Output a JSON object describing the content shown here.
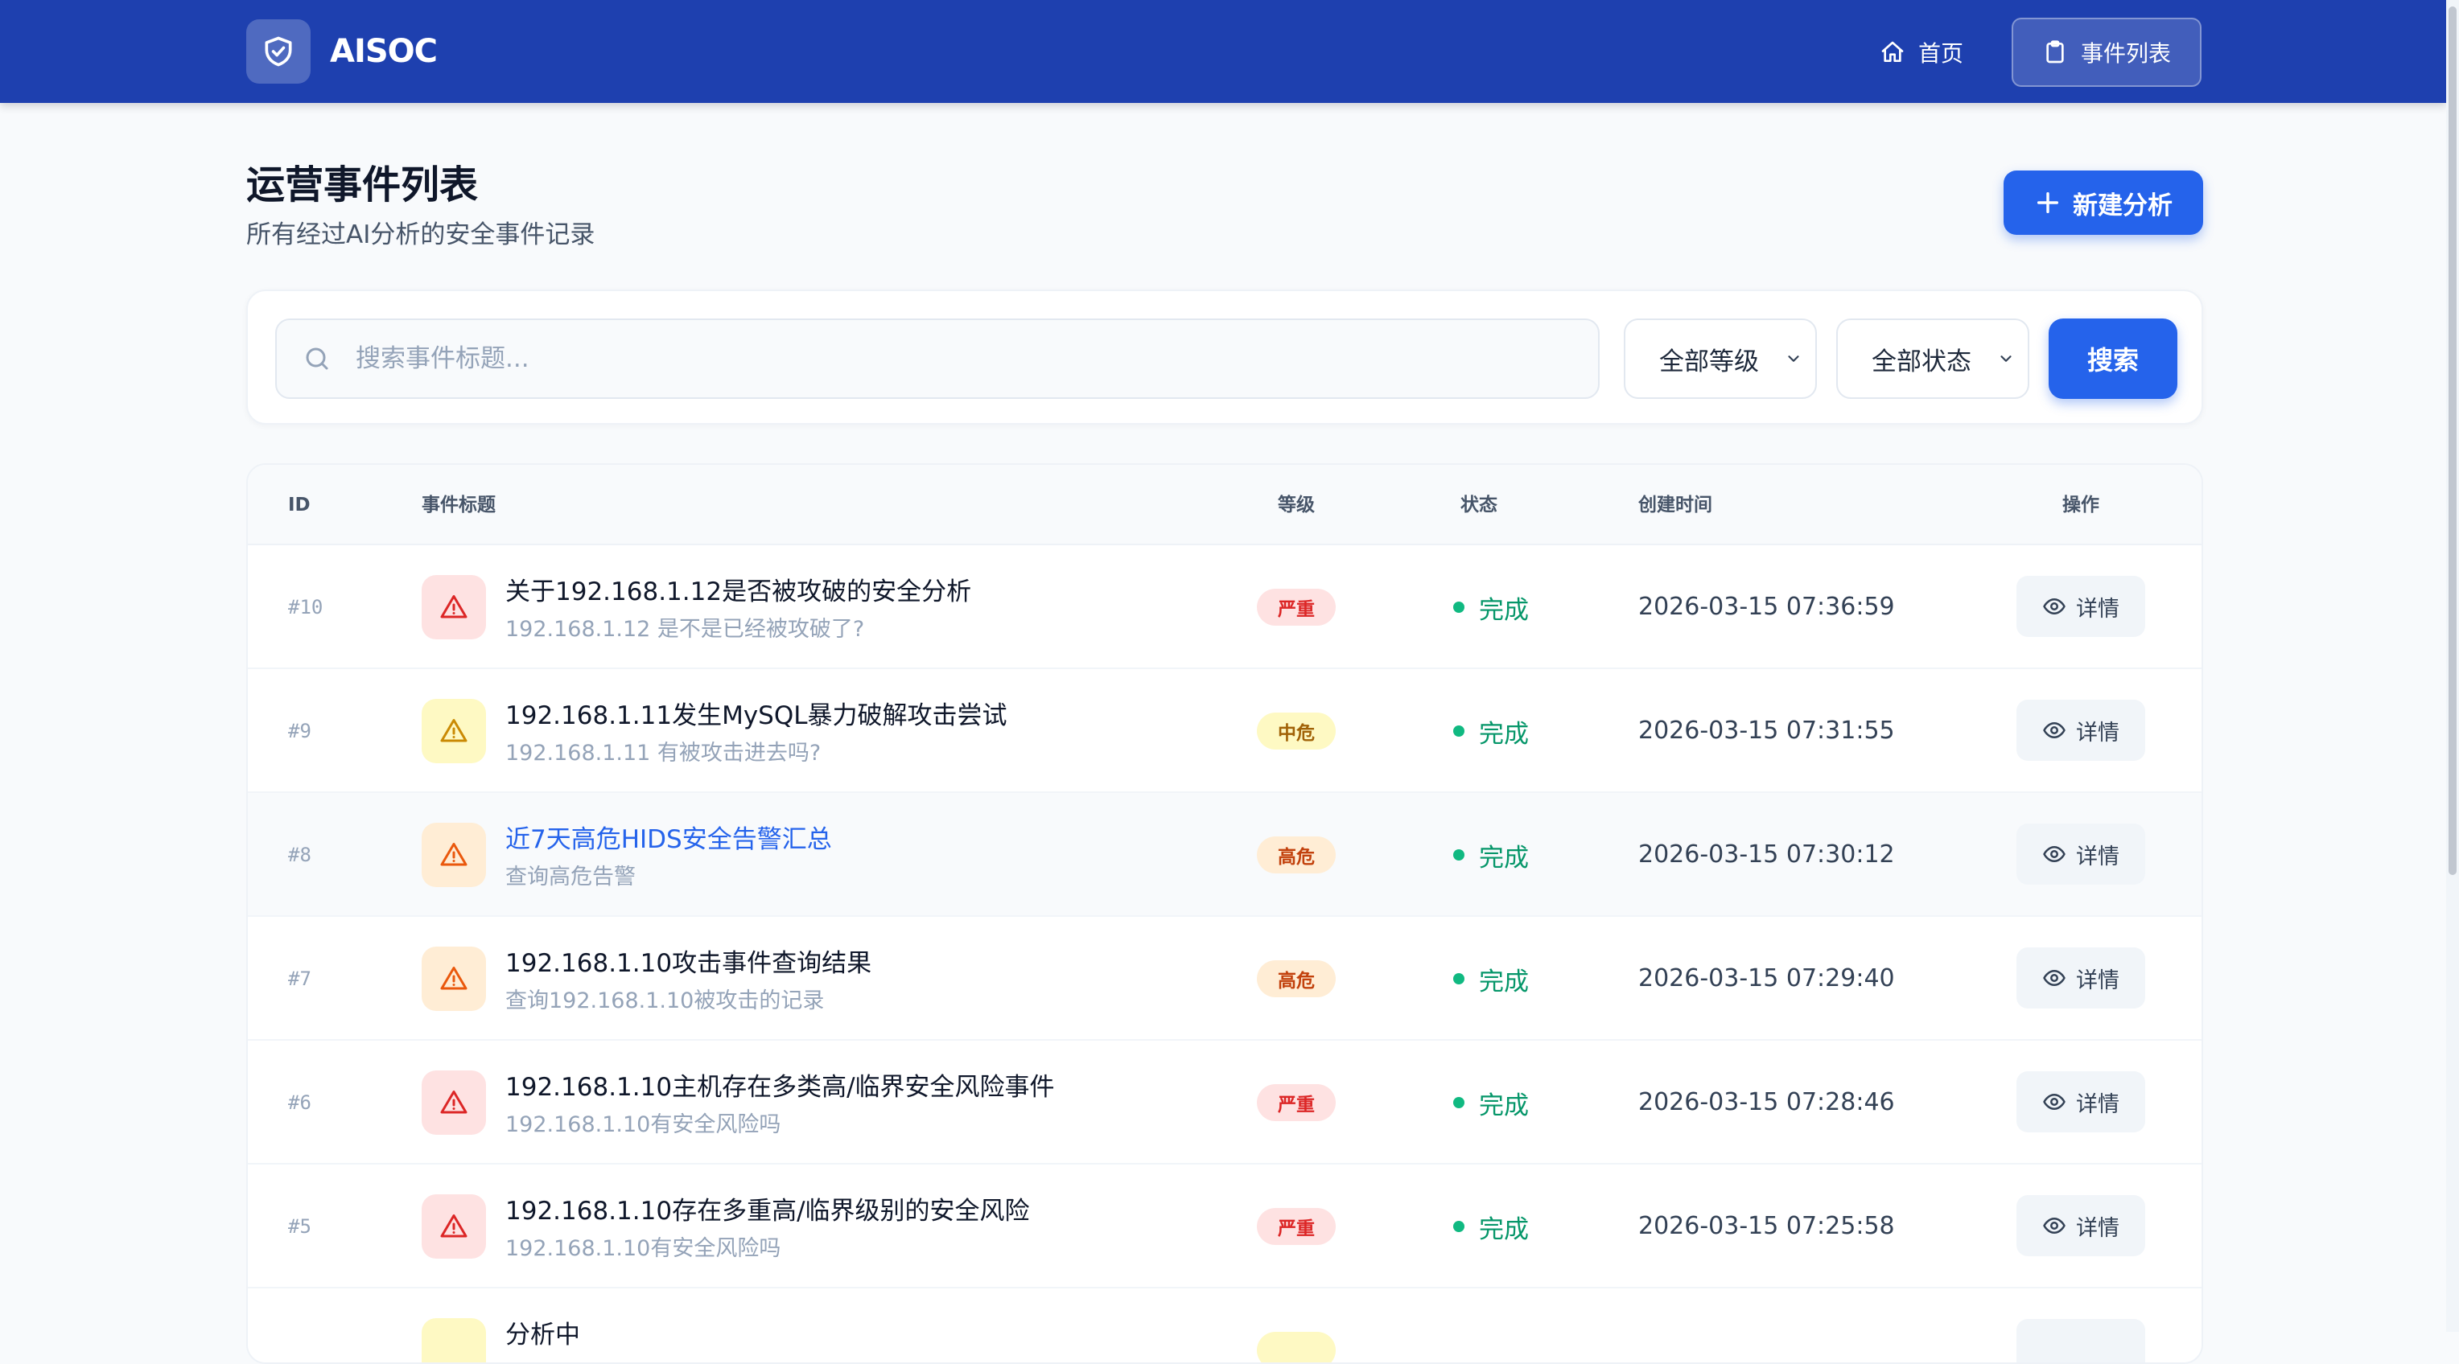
{
  "app": {
    "name": "AISOC"
  },
  "nav": {
    "home": "首页",
    "events": "事件列表"
  },
  "page": {
    "title": "运营事件列表",
    "subtitle": "所有经过AI分析的安全事件记录",
    "new_button": "新建分析"
  },
  "filters": {
    "search_placeholder": "搜索事件标题...",
    "level_selected": "全部等级",
    "status_selected": "全部状态",
    "search_button": "搜索"
  },
  "table": {
    "headers": {
      "id": "ID",
      "title": "事件标题",
      "level": "等级",
      "status": "状态",
      "created": "创建时间",
      "action": "操作"
    },
    "rows": [
      {
        "id": "#10",
        "title": "关于192.168.1.12是否被攻破的安全分析",
        "subtitle": "192.168.1.12 是不是已经被攻破了?",
        "level": "严重",
        "status": "完成",
        "created": "2026-03-15 07:36:59",
        "action": "详情"
      },
      {
        "id": "#9",
        "title": "192.168.1.11发生MySQL暴力破解攻击尝试",
        "subtitle": "192.168.1.11 有被攻击进去吗?",
        "level": "中危",
        "status": "完成",
        "created": "2026-03-15 07:31:55",
        "action": "详情"
      },
      {
        "id": "#8",
        "title": "近7天高危HIDS安全告警汇总",
        "subtitle": "查询高危告警",
        "level": "高危",
        "status": "完成",
        "created": "2026-03-15 07:30:12",
        "action": "详情"
      },
      {
        "id": "#7",
        "title": "192.168.1.10攻击事件查询结果",
        "subtitle": "查询192.168.1.10被攻击的记录",
        "level": "高危",
        "status": "完成",
        "created": "2026-03-15 07:29:40",
        "action": "详情"
      },
      {
        "id": "#6",
        "title": "192.168.1.10主机存在多类高/临界安全风险事件",
        "subtitle": "192.168.1.10有安全风险吗",
        "level": "严重",
        "status": "完成",
        "created": "2026-03-15 07:28:46",
        "action": "详情"
      },
      {
        "id": "#5",
        "title": "192.168.1.10存在多重高/临界级别的安全风险",
        "subtitle": "192.168.1.10有安全风险吗",
        "level": "严重",
        "status": "完成",
        "created": "2026-03-15 07:25:58",
        "action": "详情"
      },
      {
        "id": "",
        "title": "分析中",
        "subtitle": "",
        "level": "",
        "status": "",
        "created": "",
        "action": ""
      }
    ]
  },
  "colors": {
    "header": "#1e40af",
    "primary": "#2563eb",
    "severe": "#dc2626",
    "medium": "#ca8a04",
    "high": "#ea580c",
    "done": "#059669"
  }
}
